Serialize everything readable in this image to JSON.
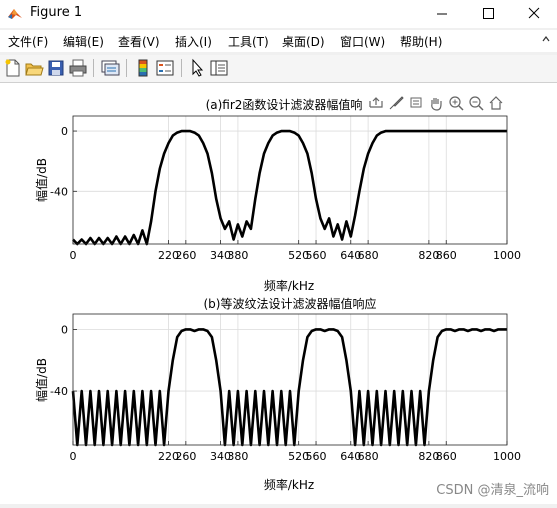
{
  "window": {
    "title": "Figure 1"
  },
  "menu": {
    "items": [
      "文件(F)",
      "编辑(E)",
      "查看(V)",
      "插入(I)",
      "工具(T)",
      "桌面(D)",
      "窗口(W)",
      "帮助(H)"
    ]
  },
  "toolbar": {
    "icons": [
      "new-figure-icon",
      "open-file-icon",
      "save-icon",
      "print-icon",
      "link-plot-icon",
      "insert-colorbar-icon",
      "insert-legend-icon",
      "edit-plot-arrow-icon",
      "property-inspector-icon"
    ]
  },
  "axes_toolbar": {
    "icons": [
      "export-icon",
      "brush-icon",
      "datatip-icon",
      "pan-icon",
      "zoom-in-icon",
      "zoom-out-icon",
      "home-icon"
    ]
  },
  "colors": {
    "line": "#000000",
    "grid": "#dcdcdc",
    "axis": "#262626"
  },
  "watermark": "CSDN @清泉_流响",
  "chart_data": [
    {
      "type": "line",
      "title": "(a)fir2函数设计滤波器幅值响",
      "xlabel": "频率/kHz",
      "ylabel": "幅值/dB",
      "xlim": [
        0,
        1000
      ],
      "ylim": [
        -75,
        10
      ],
      "xticks": [
        0,
        220,
        260,
        340,
        380,
        520,
        560,
        640,
        680,
        820,
        860,
        1000
      ],
      "yticks": [
        0,
        -40
      ],
      "grid": true,
      "x": [
        0,
        10,
        20,
        30,
        40,
        50,
        60,
        70,
        80,
        90,
        100,
        110,
        120,
        130,
        140,
        150,
        160,
        170,
        180,
        190,
        200,
        210,
        220,
        230,
        240,
        250,
        260,
        270,
        280,
        290,
        300,
        310,
        320,
        330,
        340,
        350,
        360,
        370,
        380,
        390,
        400,
        410,
        420,
        430,
        440,
        450,
        460,
        470,
        480,
        490,
        500,
        510,
        520,
        530,
        540,
        550,
        560,
        570,
        580,
        590,
        600,
        610,
        620,
        630,
        640,
        650,
        660,
        670,
        680,
        690,
        700,
        710,
        720,
        730,
        740,
        750,
        760,
        770,
        780,
        790,
        800,
        810,
        820,
        830,
        840,
        850,
        860,
        870,
        880,
        890,
        900,
        910,
        920,
        930,
        940,
        950,
        960,
        970,
        980,
        990,
        1000
      ],
      "values": [
        -72,
        -78,
        -72,
        -78,
        -71,
        -78,
        -71,
        -78,
        -71,
        -77,
        -70,
        -77,
        -70,
        -76,
        -69,
        -75,
        -66,
        -78,
        -60,
        -40,
        -25,
        -15,
        -8,
        -3,
        -1,
        0,
        0,
        0,
        -1,
        -3,
        -8,
        -15,
        -28,
        -45,
        -58,
        -65,
        -60,
        -72,
        -62,
        -70,
        -60,
        -65,
        -45,
        -28,
        -15,
        -8,
        -3,
        -1,
        0,
        0,
        0,
        -1,
        -3,
        -8,
        -15,
        -28,
        -45,
        -58,
        -65,
        -58,
        -70,
        -62,
        -72,
        -60,
        -70,
        -56,
        -40,
        -25,
        -15,
        -8,
        -3,
        -1,
        0,
        0,
        0,
        0,
        0,
        0,
        0,
        0,
        0,
        0,
        0,
        0,
        0,
        0,
        0,
        0,
        0,
        0,
        0,
        0,
        0,
        0,
        0,
        0,
        0,
        0,
        0,
        0,
        0
      ]
    },
    {
      "type": "line",
      "title": "(b)等波纹法设计滤波器幅值响应",
      "xlabel": "频率/kHz",
      "ylabel": "幅值/dB",
      "xlim": [
        0,
        1000
      ],
      "ylim": [
        -75,
        10
      ],
      "xticks": [
        0,
        220,
        260,
        340,
        380,
        520,
        560,
        640,
        680,
        820,
        860,
        1000
      ],
      "yticks": [
        0,
        -40
      ],
      "grid": true,
      "x": [
        0,
        10,
        20,
        30,
        40,
        50,
        60,
        70,
        80,
        90,
        100,
        110,
        120,
        130,
        140,
        150,
        160,
        170,
        180,
        190,
        200,
        210,
        220,
        230,
        240,
        250,
        260,
        270,
        280,
        290,
        300,
        310,
        320,
        330,
        340,
        350,
        360,
        370,
        380,
        390,
        400,
        410,
        420,
        430,
        440,
        450,
        460,
        470,
        480,
        490,
        500,
        510,
        520,
        530,
        540,
        550,
        560,
        570,
        580,
        590,
        600,
        610,
        620,
        630,
        640,
        650,
        660,
        670,
        680,
        690,
        700,
        710,
        720,
        730,
        740,
        750,
        760,
        770,
        780,
        790,
        800,
        810,
        820,
        830,
        840,
        850,
        860,
        870,
        880,
        890,
        900,
        910,
        920,
        930,
        940,
        950,
        960,
        970,
        980,
        990,
        1000
      ],
      "values": [
        -40,
        -80,
        -40,
        -80,
        -40,
        -80,
        -40,
        -80,
        -40,
        -80,
        -40,
        -80,
        -40,
        -80,
        -40,
        -80,
        -40,
        -80,
        -40,
        -80,
        -40,
        -80,
        -40,
        -20,
        -5,
        -1,
        0,
        0,
        -1,
        0,
        0,
        -1,
        -5,
        -20,
        -40,
        -80,
        -40,
        -80,
        -40,
        -80,
        -40,
        -80,
        -40,
        -80,
        -40,
        -80,
        -40,
        -80,
        -40,
        -80,
        -40,
        -80,
        -40,
        -20,
        -5,
        -1,
        0,
        0,
        -1,
        0,
        0,
        -1,
        -5,
        -20,
        -40,
        -80,
        -40,
        -80,
        -40,
        -80,
        -40,
        -80,
        -40,
        -80,
        -40,
        -80,
        -40,
        -80,
        -40,
        -80,
        -40,
        -80,
        -40,
        -20,
        -5,
        -1,
        0,
        0,
        -1,
        0,
        0,
        -1,
        0,
        0,
        -1,
        0,
        0,
        -1,
        0,
        0,
        0
      ]
    }
  ]
}
